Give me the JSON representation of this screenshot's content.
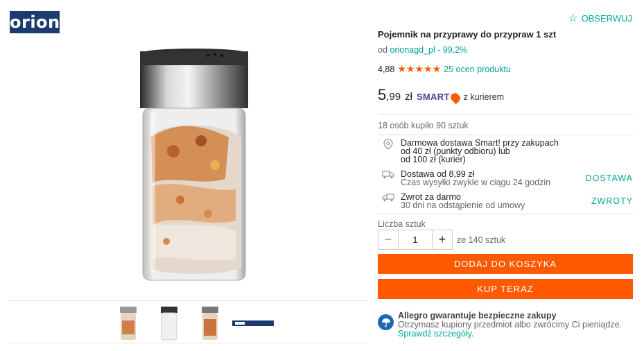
{
  "brand": {
    "logo_text": "orion"
  },
  "header": {
    "watch_label": "OBSERWUJ"
  },
  "product": {
    "title": "Pojemnik na przyprawy do przypraw 1 szt",
    "seller_prefix": "od",
    "seller_name": "orionagd_pl",
    "seller_rating": "- 99,2%",
    "rating_value": "4,88",
    "rating_stars": 5,
    "reviews_link": "25 ocen produktu",
    "price_int": "5",
    "price_dec": ",99",
    "price_currency": "zł",
    "smart_label": "SMART",
    "courier_text": "z kurierem",
    "sold_text": "18 osób kupiło 90 sztuk"
  },
  "delivery": {
    "free_line1": "Darmowa dostawa Smart! przy zakupach",
    "free_line2": "od 40 zł (punkty odbioru) lub",
    "free_line3": "od 100 zł (kurier)",
    "shipping_title": "Dostawa od 8,99 zł",
    "shipping_sub": "Czas wysyłki zwykle w ciągu 24 godzin",
    "shipping_link": "DOSTAWA",
    "return_title": "Zwrot za darmo",
    "return_sub": "30 dni na odstąpienie od umowy",
    "return_link": "ZWROTY"
  },
  "quantity": {
    "label": "Liczba sztuk",
    "value": "1",
    "minus": "−",
    "plus": "+",
    "available": "ze 140 sztuk"
  },
  "actions": {
    "add_to_cart": "DODAJ DO KOSZYKA",
    "buy_now": "KUP TERAZ"
  },
  "guarantee": {
    "heading": "Allegro gwarantuje bezpieczne zakupy",
    "body": "Otrzymasz kupiony przedmiot albo zwrócimy Ci pieniądze.",
    "link": "Sprawdź szczegóły."
  },
  "colors": {
    "accent": "#ff5a00",
    "link": "#00a790",
    "smart": "#4c3d9e",
    "logo_bg": "#1d3b70"
  }
}
